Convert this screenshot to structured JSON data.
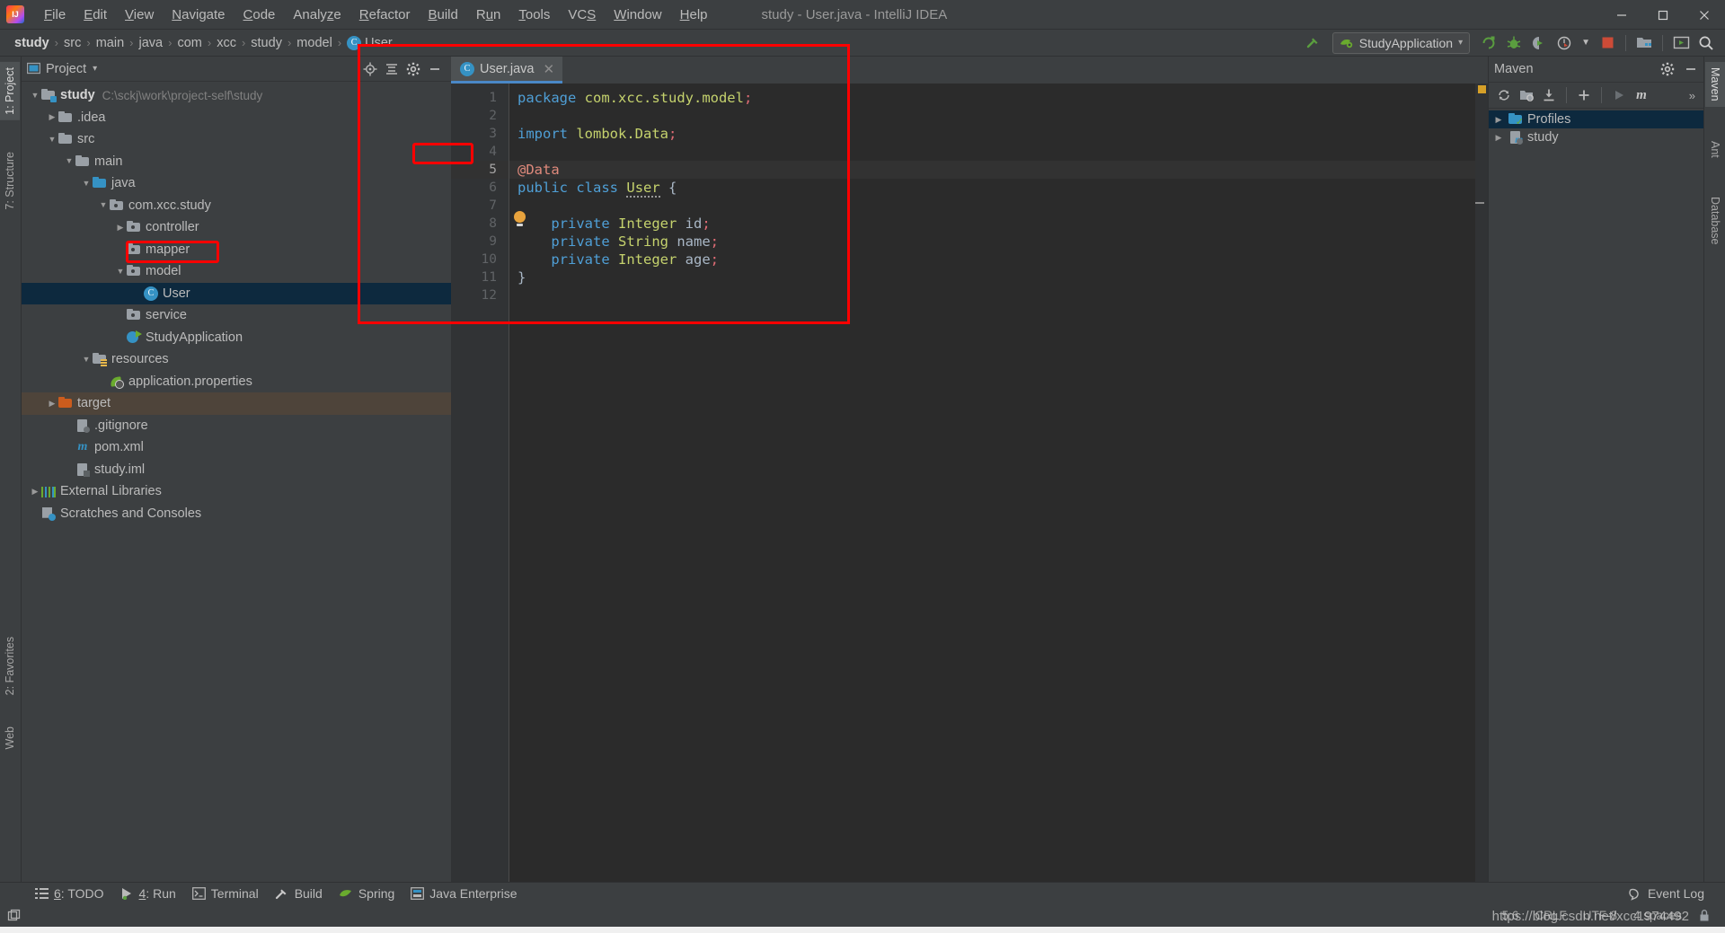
{
  "window": {
    "title": "study - User.java - IntelliJ IDEA",
    "minimize": "—",
    "maximize": "❐",
    "close": "✕"
  },
  "menu": {
    "items": [
      {
        "label": "File",
        "mnemonic": "F"
      },
      {
        "label": "Edit",
        "mnemonic": "E"
      },
      {
        "label": "View",
        "mnemonic": "V"
      },
      {
        "label": "Navigate",
        "mnemonic": "N"
      },
      {
        "label": "Code",
        "mnemonic": "C"
      },
      {
        "label": "Analyze",
        "mnemonic": "z"
      },
      {
        "label": "Refactor",
        "mnemonic": "R"
      },
      {
        "label": "Build",
        "mnemonic": "B"
      },
      {
        "label": "Run",
        "mnemonic": "u"
      },
      {
        "label": "Tools",
        "mnemonic": "T"
      },
      {
        "label": "VCS",
        "mnemonic": "S"
      },
      {
        "label": "Window",
        "mnemonic": "W"
      },
      {
        "label": "Help",
        "mnemonic": "H"
      }
    ]
  },
  "breadcrumb": {
    "items": [
      "study",
      "src",
      "main",
      "java",
      "com",
      "xcc",
      "study",
      "model",
      "User"
    ],
    "separator": "›"
  },
  "toolbar": {
    "run_config": "StudyApplication",
    "run_config_caret": "▾",
    "icons": [
      "hammer-build-icon",
      "run-icon",
      "debug-icon",
      "coverage-icon",
      "profiler-icon",
      "stop-icon",
      "project-structure-icon",
      "update-project-icon",
      "search-everywhere-icon"
    ]
  },
  "left_stripe": {
    "tabs": [
      {
        "label": "1: Project",
        "selected": true
      },
      {
        "label": "7: Structure",
        "selected": false
      },
      {
        "label": "2: Favorites",
        "selected": false
      },
      {
        "label": "Web",
        "selected": false
      }
    ]
  },
  "right_stripe": {
    "tabs": [
      {
        "label": "Maven",
        "selected": true
      },
      {
        "label": "Ant",
        "selected": false
      },
      {
        "label": "Database",
        "selected": false
      }
    ]
  },
  "project_panel": {
    "title": "Project",
    "caret": "▾",
    "icons": [
      "locate-icon",
      "collapse-all-icon",
      "settings-gear-icon",
      "hide-icon"
    ],
    "tree": [
      {
        "label": "study",
        "detail": "C:\\sckj\\work\\project-self\\study",
        "indent": 0,
        "arrow": "▼",
        "icon": "module-folder-icon",
        "bold": true,
        "selected": false
      },
      {
        "label": ".idea",
        "detail": "",
        "indent": 1,
        "arrow": "▶",
        "icon": "folder-icon",
        "bold": false,
        "selected": false
      },
      {
        "label": "src",
        "detail": "",
        "indent": 1,
        "arrow": "▼",
        "icon": "folder-icon",
        "bold": false,
        "selected": false
      },
      {
        "label": "main",
        "detail": "",
        "indent": 2,
        "arrow": "▼",
        "icon": "folder-icon",
        "bold": false,
        "selected": false
      },
      {
        "label": "java",
        "detail": "",
        "indent": 3,
        "arrow": "▼",
        "icon": "source-folder-icon",
        "bold": false,
        "selected": false
      },
      {
        "label": "com.xcc.study",
        "detail": "",
        "indent": 4,
        "arrow": "▼",
        "icon": "package-icon",
        "bold": false,
        "selected": false
      },
      {
        "label": "controller",
        "detail": "",
        "indent": 5,
        "arrow": "▶",
        "icon": "package-icon",
        "bold": false,
        "selected": false
      },
      {
        "label": "mapper",
        "detail": "",
        "indent": 5,
        "arrow": "",
        "icon": "package-icon",
        "bold": false,
        "selected": false
      },
      {
        "label": "model",
        "detail": "",
        "indent": 5,
        "arrow": "▼",
        "icon": "package-icon",
        "bold": false,
        "selected": false
      },
      {
        "label": "User",
        "detail": "",
        "indent": 6,
        "arrow": "",
        "icon": "java-class-icon",
        "bold": false,
        "selected": true
      },
      {
        "label": "service",
        "detail": "",
        "indent": 5,
        "arrow": "",
        "icon": "package-icon",
        "bold": false,
        "selected": false
      },
      {
        "label": "StudyApplication",
        "detail": "",
        "indent": 5,
        "arrow": "",
        "icon": "spring-boot-class-icon",
        "bold": false,
        "selected": false
      },
      {
        "label": "resources",
        "detail": "",
        "indent": 3,
        "arrow": "▼",
        "icon": "resources-folder-icon",
        "bold": false,
        "selected": false
      },
      {
        "label": "application.properties",
        "detail": "",
        "indent": 4,
        "arrow": "",
        "icon": "spring-properties-icon",
        "bold": false,
        "selected": false
      },
      {
        "label": "target",
        "detail": "",
        "indent": 1,
        "arrow": "▶",
        "icon": "excluded-folder-icon",
        "bold": false,
        "selected": false,
        "highlight": true
      },
      {
        "label": ".gitignore",
        "detail": "",
        "indent": 2,
        "arrow": "",
        "icon": "ignored-file-icon",
        "bold": false,
        "selected": false
      },
      {
        "label": "pom.xml",
        "detail": "",
        "indent": 2,
        "arrow": "",
        "icon": "maven-file-icon",
        "bold": false,
        "selected": false
      },
      {
        "label": "study.iml",
        "detail": "",
        "indent": 2,
        "arrow": "",
        "icon": "iml-file-icon",
        "bold": false,
        "selected": false
      },
      {
        "label": "External Libraries",
        "detail": "",
        "indent": 0,
        "arrow": "▶",
        "icon": "libraries-icon",
        "bold": false,
        "selected": false
      },
      {
        "label": "Scratches and Consoles",
        "detail": "",
        "indent": 0,
        "arrow": "",
        "icon": "scratches-icon",
        "bold": false,
        "selected": false
      }
    ]
  },
  "editor": {
    "tab": {
      "label": "User.java",
      "icon": "java-class-icon",
      "close": "✕"
    },
    "line_numbers": [
      "1",
      "2",
      "3",
      "4",
      "5",
      "6",
      "7",
      "8",
      "9",
      "10",
      "11",
      "12"
    ],
    "current_line": 5,
    "lines": [
      {
        "n": 1,
        "tokens": [
          {
            "t": "package",
            "c": "kw"
          },
          {
            "t": " ",
            "c": "pl"
          },
          {
            "t": "com.xcc.study.model",
            "c": "type"
          },
          {
            "t": ";",
            "c": "semi"
          }
        ]
      },
      {
        "n": 2,
        "tokens": []
      },
      {
        "n": 3,
        "tokens": [
          {
            "t": "import",
            "c": "kw"
          },
          {
            "t": " lombok.",
            "c": "type"
          },
          {
            "t": "Data",
            "c": "type"
          },
          {
            "t": ";",
            "c": "semi"
          }
        ]
      },
      {
        "n": 4,
        "tokens": []
      },
      {
        "n": 5,
        "tokens": [
          {
            "t": "@Data",
            "c": "ann"
          }
        ]
      },
      {
        "n": 6,
        "tokens": [
          {
            "t": "public",
            "c": "kw"
          },
          {
            "t": " ",
            "c": "pl"
          },
          {
            "t": "class",
            "c": "kw"
          },
          {
            "t": " ",
            "c": "pl"
          },
          {
            "t": "User",
            "c": "cls"
          },
          {
            "t": " {",
            "c": "pl"
          }
        ]
      },
      {
        "n": 7,
        "tokens": []
      },
      {
        "n": 8,
        "tokens": [
          {
            "t": "    ",
            "c": "pl"
          },
          {
            "t": "private",
            "c": "kw"
          },
          {
            "t": " ",
            "c": "pl"
          },
          {
            "t": "Integer",
            "c": "type"
          },
          {
            "t": " id",
            "c": "pl"
          },
          {
            "t": ";",
            "c": "semi"
          }
        ]
      },
      {
        "n": 9,
        "tokens": [
          {
            "t": "    ",
            "c": "pl"
          },
          {
            "t": "private",
            "c": "kw"
          },
          {
            "t": " ",
            "c": "pl"
          },
          {
            "t": "String",
            "c": "type"
          },
          {
            "t": " name",
            "c": "pl"
          },
          {
            "t": ";",
            "c": "semi"
          }
        ]
      },
      {
        "n": 10,
        "tokens": [
          {
            "t": "    ",
            "c": "pl"
          },
          {
            "t": "private",
            "c": "kw"
          },
          {
            "t": " ",
            "c": "pl"
          },
          {
            "t": "Integer",
            "c": "type"
          },
          {
            "t": " age",
            "c": "pl"
          },
          {
            "t": ";",
            "c": "semi"
          }
        ]
      },
      {
        "n": 11,
        "tokens": [
          {
            "t": "}",
            "c": "pl"
          }
        ]
      },
      {
        "n": 12,
        "tokens": []
      }
    ],
    "intention_bulb": "lightbulb-icon"
  },
  "maven_panel": {
    "title": "Maven",
    "head_icons": [
      "settings-gear-icon",
      "hide-icon"
    ],
    "toolbar_icons": [
      "reimport-icon",
      "generate-sources-icon",
      "download-sources-icon",
      "add-maven-project-icon",
      "run-icon",
      "execute-goal-icon",
      "expand-icon"
    ],
    "toolbar_expand": "»",
    "tree": [
      {
        "label": "Profiles",
        "arrow": "▶",
        "icon": "profiles-icon",
        "selected": true
      },
      {
        "label": "study",
        "arrow": "▶",
        "icon": "maven-project-icon",
        "selected": false
      }
    ]
  },
  "bottom_bar": {
    "tools": [
      {
        "label": "6: TODO",
        "mnemonic": "6",
        "icon": "todo-list-icon"
      },
      {
        "label": "4: Run",
        "mnemonic": "4",
        "icon": "run-icon"
      },
      {
        "label": "Terminal",
        "mnemonic": "",
        "icon": "terminal-icon"
      },
      {
        "label": "Build",
        "mnemonic": "",
        "icon": "hammer-build-icon"
      },
      {
        "label": "Spring",
        "mnemonic": "",
        "icon": "spring-leaf-icon"
      },
      {
        "label": "Java Enterprise",
        "mnemonic": "",
        "icon": "java-enterprise-icon"
      }
    ],
    "event_log": {
      "label": "Event Log",
      "icon": "event-log-icon"
    }
  },
  "status_bar": {
    "caret_position": "5:6",
    "line_separator": "CRLF",
    "encoding": "UTF-8",
    "indent": "4 spaces",
    "lock_icon": "lock-icon",
    "watermark": "https://blog.csdn.net/xcc1974492"
  },
  "annotations": {
    "boxes": [
      {
        "name": "editor-highlight-box",
        "color": "#ff0000"
      },
      {
        "name": "data-annotation-box",
        "color": "#ff0000"
      },
      {
        "name": "user-class-box",
        "color": "#ff0000"
      }
    ]
  },
  "colors": {
    "accent_blue": "#3592c4",
    "selection_blue": "#0d293e",
    "annotation_red": "#ff0000",
    "panel_bg": "#3c3f41",
    "editor_bg": "#2b2b2b"
  }
}
